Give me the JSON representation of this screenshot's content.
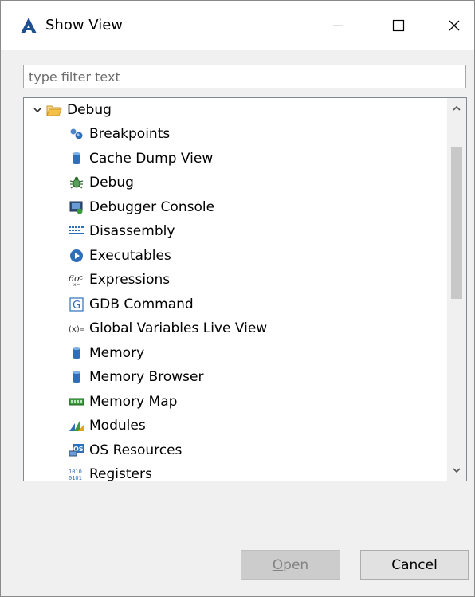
{
  "window": {
    "title": "Show View"
  },
  "filter": {
    "placeholder": "type filter text"
  },
  "tree": {
    "group": {
      "label": "Debug",
      "expanded": true
    },
    "items": [
      {
        "label": "Breakpoints",
        "icon": "breakpoints-icon"
      },
      {
        "label": "Cache Dump View",
        "icon": "memory-cylinder-icon"
      },
      {
        "label": "Debug",
        "icon": "bug-icon"
      },
      {
        "label": "Debugger Console",
        "icon": "console-icon"
      },
      {
        "label": "Disassembly",
        "icon": "disassembly-icon"
      },
      {
        "label": "Executables",
        "icon": "executables-icon"
      },
      {
        "label": "Expressions",
        "icon": "expressions-icon"
      },
      {
        "label": "GDB Command",
        "icon": "gdb-icon"
      },
      {
        "label": "Global Variables Live View",
        "icon": "variables-icon"
      },
      {
        "label": "Memory",
        "icon": "memory-cylinder-icon"
      },
      {
        "label": "Memory Browser",
        "icon": "memory-cylinder-icon"
      },
      {
        "label": "Memory Map",
        "icon": "memory-map-icon"
      },
      {
        "label": "Modules",
        "icon": "modules-icon"
      },
      {
        "label": "OS Resources",
        "icon": "os-resources-icon"
      },
      {
        "label": "Registers",
        "icon": "registers-icon"
      }
    ]
  },
  "buttons": {
    "open_prefix": "O",
    "open_rest": "pen",
    "cancel": "Cancel"
  },
  "colors": {
    "folder": "#f5c048",
    "blue": "#2f6fb8",
    "green": "#3b9a3b"
  }
}
